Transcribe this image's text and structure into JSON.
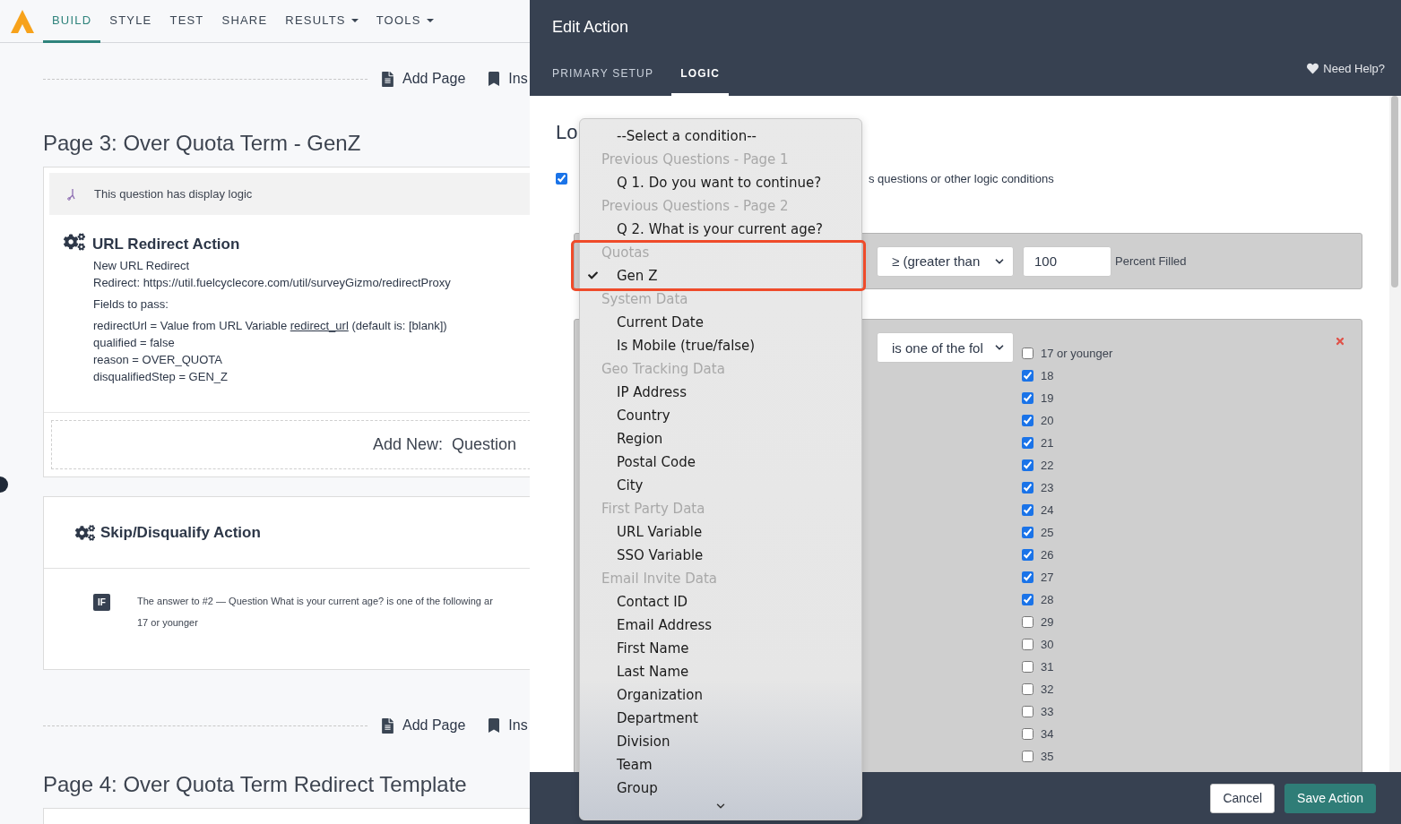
{
  "nav": {
    "tabs": [
      {
        "label": "BUILD",
        "selected": true,
        "caret": false
      },
      {
        "label": "STYLE",
        "selected": false,
        "caret": false
      },
      {
        "label": "TEST",
        "selected": false,
        "caret": false
      },
      {
        "label": "SHARE",
        "selected": false,
        "caret": false
      },
      {
        "label": "RESULTS",
        "selected": false,
        "caret": true
      },
      {
        "label": "TOOLS",
        "selected": false,
        "caret": true
      }
    ]
  },
  "builder": {
    "toolbar_top": {
      "add_page": "Add Page",
      "insert": "Ins"
    },
    "page3": {
      "title": "Page 3: Over Quota Term - GenZ",
      "display_logic": "This question has display logic",
      "redirect_action": {
        "title": "URL Redirect Action",
        "intro": [
          "New URL Redirect",
          "Redirect: https://util.fuelcyclecore.com/util/surveyGizmo/redirectProxy"
        ],
        "fields_heading": "Fields to pass:",
        "link_field": {
          "before": "redirectUrl = Value from URL Variable ",
          "link": "redirect_url",
          "after": " (default is: [blank])"
        },
        "fields": [
          "qualified = false",
          "reason = OVER_QUOTA",
          "disqualifiedStep = GEN_Z"
        ]
      },
      "add_new": {
        "label": "Add New:",
        "value": "Question"
      }
    },
    "skip_action": {
      "title": "Skip/Disqualify Action",
      "badge": "IF",
      "condition": "The answer to #2 — Question What is your current age? is one of the following ar",
      "answer": "17 or younger"
    },
    "toolbar_bottom": {
      "add_page": "Add Page",
      "insert": "Ins"
    },
    "page4": {
      "title": "Page 4: Over Quota Term Redirect Template"
    }
  },
  "modal": {
    "title": "Edit Action",
    "tabs": [
      {
        "label": "PRIMARY SETUP",
        "selected": false
      },
      {
        "label": "LOGIC",
        "selected": true
      }
    ],
    "help": "Need Help?",
    "heading": "Lo",
    "enable": {
      "checked": true,
      "label": "s questions or other logic conditions"
    },
    "quota_condition": {
      "operator": "≥ (greater than",
      "value": "100",
      "unit": "Percent Filled"
    },
    "answer_condition": {
      "operator": "is one of the fol",
      "options": [
        {
          "label": "17 or younger",
          "checked": false
        },
        {
          "label": "18",
          "checked": true
        },
        {
          "label": "19",
          "checked": true
        },
        {
          "label": "20",
          "checked": true
        },
        {
          "label": "21",
          "checked": true
        },
        {
          "label": "22",
          "checked": true
        },
        {
          "label": "23",
          "checked": true
        },
        {
          "label": "24",
          "checked": true
        },
        {
          "label": "25",
          "checked": true
        },
        {
          "label": "26",
          "checked": true
        },
        {
          "label": "27",
          "checked": true
        },
        {
          "label": "28",
          "checked": true
        },
        {
          "label": "29",
          "checked": false
        },
        {
          "label": "30",
          "checked": false
        },
        {
          "label": "31",
          "checked": false
        },
        {
          "label": "32",
          "checked": false
        },
        {
          "label": "33",
          "checked": false
        },
        {
          "label": "34",
          "checked": false
        },
        {
          "label": "35",
          "checked": false
        }
      ]
    },
    "buttons": [
      {
        "label": "Cancel",
        "kind": "secondary"
      },
      {
        "label": "Save Action",
        "kind": "primary"
      }
    ]
  },
  "dropdown": {
    "items": [
      {
        "kind": "option",
        "label": "--Select a condition--",
        "selected": false
      },
      {
        "kind": "group",
        "label": "Previous Questions - Page 1"
      },
      {
        "kind": "option",
        "label": "Q 1. Do you want to continue?",
        "selected": false
      },
      {
        "kind": "group",
        "label": "Previous Questions - Page 2"
      },
      {
        "kind": "option",
        "label": "Q 2. What is your current age?",
        "selected": false
      },
      {
        "kind": "group",
        "label": "Quotas"
      },
      {
        "kind": "option",
        "label": "Gen Z",
        "selected": true
      },
      {
        "kind": "group",
        "label": "System Data"
      },
      {
        "kind": "option",
        "label": "Current Date",
        "selected": false
      },
      {
        "kind": "option",
        "label": "Is Mobile (true/false)",
        "selected": false
      },
      {
        "kind": "group",
        "label": "Geo Tracking Data"
      },
      {
        "kind": "option",
        "label": "IP Address",
        "selected": false
      },
      {
        "kind": "option",
        "label": "Country",
        "selected": false
      },
      {
        "kind": "option",
        "label": "Region",
        "selected": false
      },
      {
        "kind": "option",
        "label": "Postal Code",
        "selected": false
      },
      {
        "kind": "option",
        "label": "City",
        "selected": false
      },
      {
        "kind": "group",
        "label": "First Party Data"
      },
      {
        "kind": "option",
        "label": "URL Variable",
        "selected": false
      },
      {
        "kind": "option",
        "label": "SSO Variable",
        "selected": false
      },
      {
        "kind": "group",
        "label": "Email Invite Data"
      },
      {
        "kind": "option",
        "label": "Contact ID",
        "selected": false
      },
      {
        "kind": "option",
        "label": "Email Address",
        "selected": false
      },
      {
        "kind": "option",
        "label": "First Name",
        "selected": false
      },
      {
        "kind": "option",
        "label": "Last Name",
        "selected": false
      },
      {
        "kind": "option",
        "label": "Organization",
        "selected": false
      },
      {
        "kind": "option",
        "label": "Department",
        "selected": false
      },
      {
        "kind": "option",
        "label": "Division",
        "selected": false
      },
      {
        "kind": "option",
        "label": "Team",
        "selected": false
      },
      {
        "kind": "option",
        "label": "Group",
        "selected": false
      }
    ]
  }
}
